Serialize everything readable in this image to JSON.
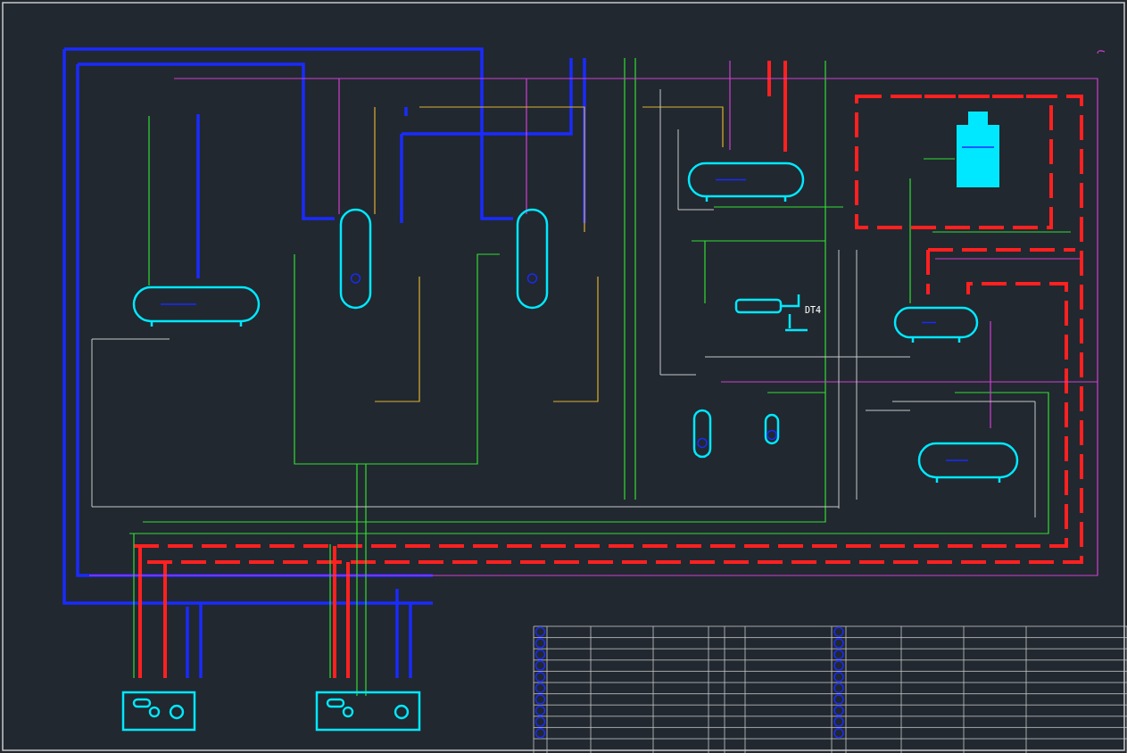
{
  "drawing": {
    "labels": [
      {
        "text": "DT4"
      }
    ]
  }
}
